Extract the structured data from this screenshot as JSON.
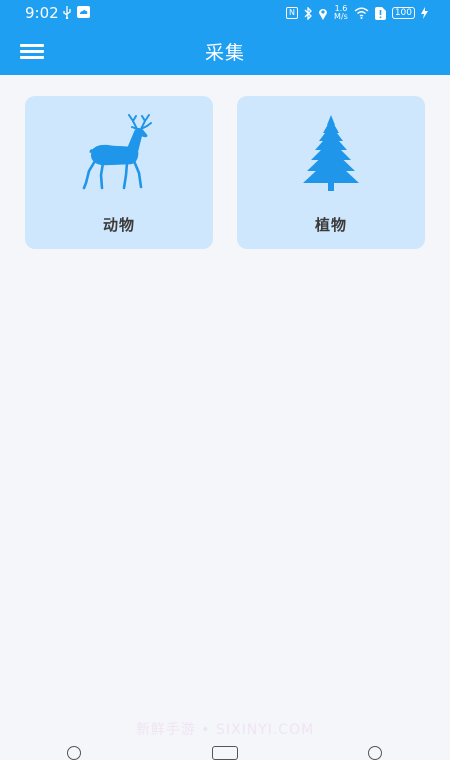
{
  "status_bar": {
    "time": "9:02",
    "speed_value": "1.6",
    "speed_unit": "M/s",
    "battery": "100"
  },
  "appbar": {
    "title": "采集",
    "menu_icon": "hamburger-menu-icon"
  },
  "categories": [
    {
      "label": "动物",
      "icon": "deer-icon"
    },
    {
      "label": "植物",
      "icon": "tree-icon"
    }
  ],
  "watermark": "新鲜手游 • SIXINYI.COM",
  "colors": {
    "primary": "#1e9ff2",
    "card_bg": "#cfe7fc",
    "page_bg": "#f4f6fa",
    "label": "#3b3b3b"
  }
}
